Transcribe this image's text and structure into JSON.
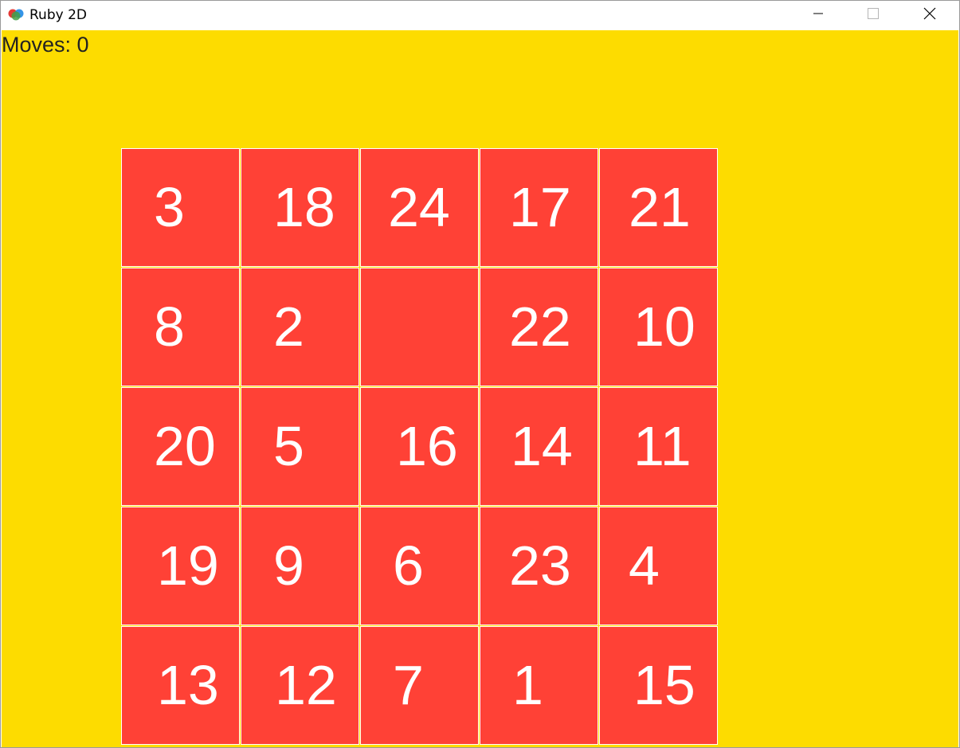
{
  "window": {
    "title": "Ruby 2D",
    "icons": {
      "app": "ruby2d-logo-icon",
      "minimize": "minimize-icon",
      "maximize": "maximize-icon",
      "close": "close-icon"
    }
  },
  "game": {
    "moves_label": "Moves: 0",
    "colors": {
      "background": "#fddc00",
      "tile": "#ff4136",
      "tile_text": "#ffffff",
      "tile_border": "#ffffff"
    },
    "grid": [
      [
        "3",
        "18",
        "24",
        "17",
        "21"
      ],
      [
        "8",
        "2",
        "",
        "22",
        "10"
      ],
      [
        "20",
        "5",
        "16",
        "14",
        "11"
      ],
      [
        "19",
        "9",
        "6",
        "23",
        "4"
      ],
      [
        "13",
        "12",
        "7",
        "1",
        "15"
      ]
    ]
  }
}
